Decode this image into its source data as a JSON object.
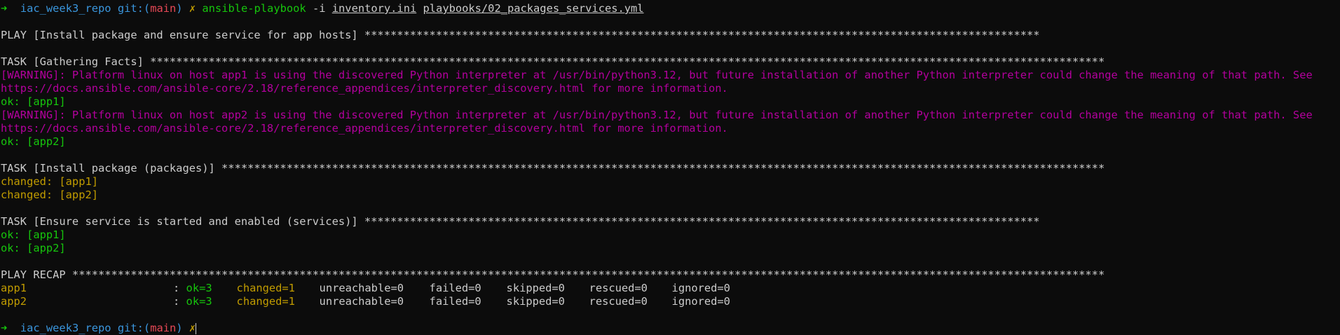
{
  "prompt": {
    "arrow": "➜",
    "dir": "iac_week3_repo",
    "git_prefix": "git:(",
    "branch": "main",
    "git_suffix": ")",
    "dirty": "✗"
  },
  "command": {
    "program": "ansible-playbook",
    "flag": "-i",
    "inventory": "inventory.ini",
    "playbook": "playbooks/02_packages_services.yml"
  },
  "output": {
    "play_header": "PLAY [Install package and ensure service for app hosts] ********************************************************************************************************",
    "task1_header": "TASK [Gathering Facts] ***************************************************************************************************************************************************",
    "warn1_a": "[WARNING]: Platform linux on host app1 is using the discovered Python interpreter at /usr/bin/python3.12, but future installation of another Python interpreter could change the meaning of that path. See",
    "warn1_b": "https://docs.ansible.com/ansible-core/2.18/reference_appendices/interpreter_discovery.html for more information.",
    "ok_app1_a": "ok: [app1]",
    "warn2_a": "[WARNING]: Platform linux on host app2 is using the discovered Python interpreter at /usr/bin/python3.12, but future installation of another Python interpreter could change the meaning of that path. See",
    "warn2_b": "https://docs.ansible.com/ansible-core/2.18/reference_appendices/interpreter_discovery.html for more information.",
    "ok_app2_a": "ok: [app2]",
    "task2_header": "TASK [Install package (packages)] ****************************************************************************************************************************************",
    "changed_app1": "changed: [app1]",
    "changed_app2": "changed: [app2]",
    "task3_header": "TASK [Ensure service is started and enabled (services)] ********************************************************************************************************",
    "ok_app1_b": "ok: [app1]",
    "ok_app2_b": "ok: [app2]",
    "recap_header": "PLAY RECAP ***************************************************************************************************************************************************************"
  },
  "recap": [
    {
      "host": "app1",
      "sep": ": ",
      "ok": "ok=3",
      "changed": "changed=1",
      "unreachable": "unreachable=0",
      "failed": "failed=0",
      "skipped": "skipped=0",
      "rescued": "rescued=0",
      "ignored": "ignored=0"
    },
    {
      "host": "app2",
      "sep": ": ",
      "ok": "ok=3",
      "changed": "changed=1",
      "unreachable": "unreachable=0",
      "failed": "failed=0",
      "skipped": "skipped=0",
      "rescued": "rescued=0",
      "ignored": "ignored=0"
    }
  ],
  "colors": {
    "background": "#0c0c0c",
    "foreground": "#cccccc",
    "ok_green": "#16c60c",
    "changed_yellow": "#c19c00",
    "warning_magenta": "#b4009e",
    "prompt_cyan": "#3a96dd",
    "branch_red": "#e74856"
  }
}
